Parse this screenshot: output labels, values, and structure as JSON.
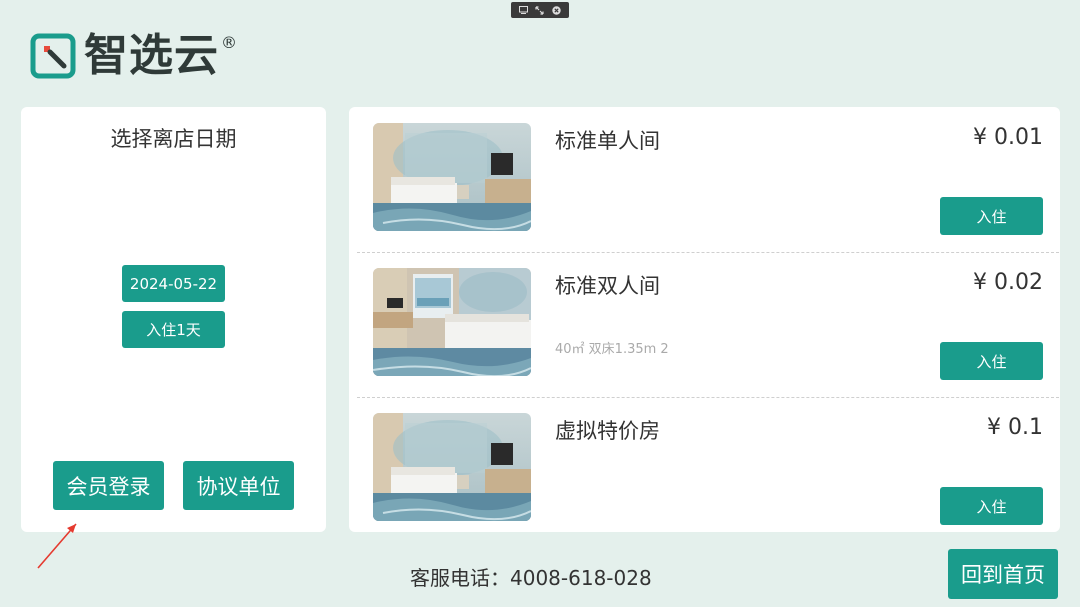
{
  "brand": {
    "name": "智选云",
    "reg_mark": "®",
    "accent": "#1a9c8c"
  },
  "left": {
    "title": "选择离店日期",
    "date": "2024-05-22",
    "stay": "入住1天",
    "member_login": "会员登录",
    "agreement_unit": "协议单位"
  },
  "rooms": [
    {
      "name": "标准单人间",
      "price": "¥ 0.01",
      "desc": "",
      "button": "入住"
    },
    {
      "name": "标准双人间",
      "price": "¥ 0.02",
      "desc": "40㎡ 双床1.35m 2",
      "button": "入住"
    },
    {
      "name": "虚拟特价房",
      "price": "¥ 0.1",
      "desc": "",
      "button": "入住"
    }
  ],
  "footer": {
    "phone": "客服电话：4008-618-028",
    "home": "回到首页"
  }
}
